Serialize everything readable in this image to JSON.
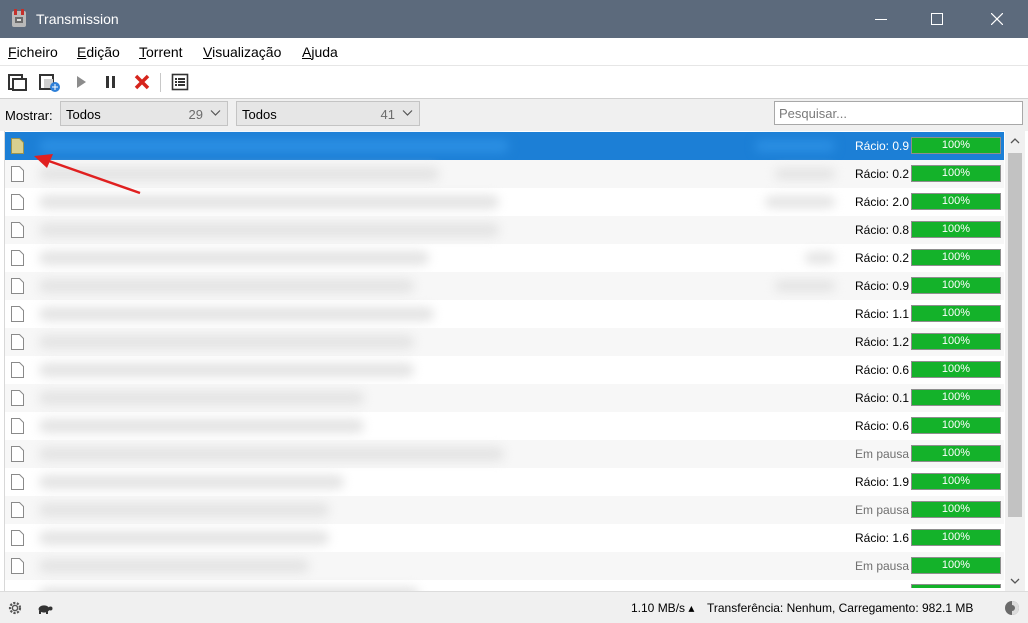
{
  "window": {
    "title": "Transmission"
  },
  "menu": [
    {
      "mnemonic": "F",
      "rest": "icheiro"
    },
    {
      "mnemonic": "E",
      "rest": "dição"
    },
    {
      "mnemonic": "T",
      "rest": "orrent"
    },
    {
      "mnemonic": "V",
      "rest": "isualização"
    },
    {
      "mnemonic": "A",
      "rest": "juda"
    }
  ],
  "toolbar": {
    "icons": [
      "open-torrent-icon",
      "open-url-icon",
      "start-icon",
      "pause-icon",
      "remove-icon",
      "properties-icon"
    ]
  },
  "filter": {
    "show_label": "Mostrar:",
    "activity": {
      "value": "Todos",
      "count": "29"
    },
    "trackers": {
      "value": "Todos",
      "count": "41"
    },
    "search_placeholder": "Pesquisar..."
  },
  "torrents": [
    {
      "status": "Rácio: 0.9",
      "progress": 100,
      "progress_label": "100%",
      "selected": true
    },
    {
      "status": "Rácio: 0.2",
      "progress": 100,
      "progress_label": "100%"
    },
    {
      "status": "Rácio: 2.0",
      "progress": 100,
      "progress_label": "100%"
    },
    {
      "status": "Rácio: 0.8",
      "progress": 100,
      "progress_label": "100%"
    },
    {
      "status": "Rácio: 0.2",
      "progress": 100,
      "progress_label": "100%"
    },
    {
      "status": "Rácio: 0.9",
      "progress": 100,
      "progress_label": "100%"
    },
    {
      "status": "Rácio: 1.1",
      "progress": 100,
      "progress_label": "100%"
    },
    {
      "status": "Rácio: 1.2",
      "progress": 100,
      "progress_label": "100%"
    },
    {
      "status": "Rácio: 0.6",
      "progress": 100,
      "progress_label": "100%"
    },
    {
      "status": "Rácio: 0.1",
      "progress": 100,
      "progress_label": "100%"
    },
    {
      "status": "Rácio: 0.6",
      "progress": 100,
      "progress_label": "100%"
    },
    {
      "status": "Em pausa",
      "progress": 100,
      "progress_label": "100%",
      "paused": true
    },
    {
      "status": "Rácio: 1.9",
      "progress": 100,
      "progress_label": "100%"
    },
    {
      "status": "Em pausa",
      "progress": 100,
      "progress_label": "100%",
      "paused": true
    },
    {
      "status": "Rácio: 1.6",
      "progress": 100,
      "progress_label": "100%"
    },
    {
      "status": "Em pausa",
      "progress": 100,
      "progress_label": "100%",
      "paused": true
    },
    {
      "status": "",
      "progress": 100,
      "progress_label": "",
      "partial": true
    }
  ],
  "status": {
    "speed": "1.10 MB/s ▴",
    "transfer": "Transferência: Nenhum, Carregamento: 982.1 MB"
  },
  "colors": {
    "titlebar": "#5c6a7c",
    "selection": "#1c7fd6",
    "progress_fill": "#14b22a",
    "annotation_arrow": "#e02020"
  }
}
